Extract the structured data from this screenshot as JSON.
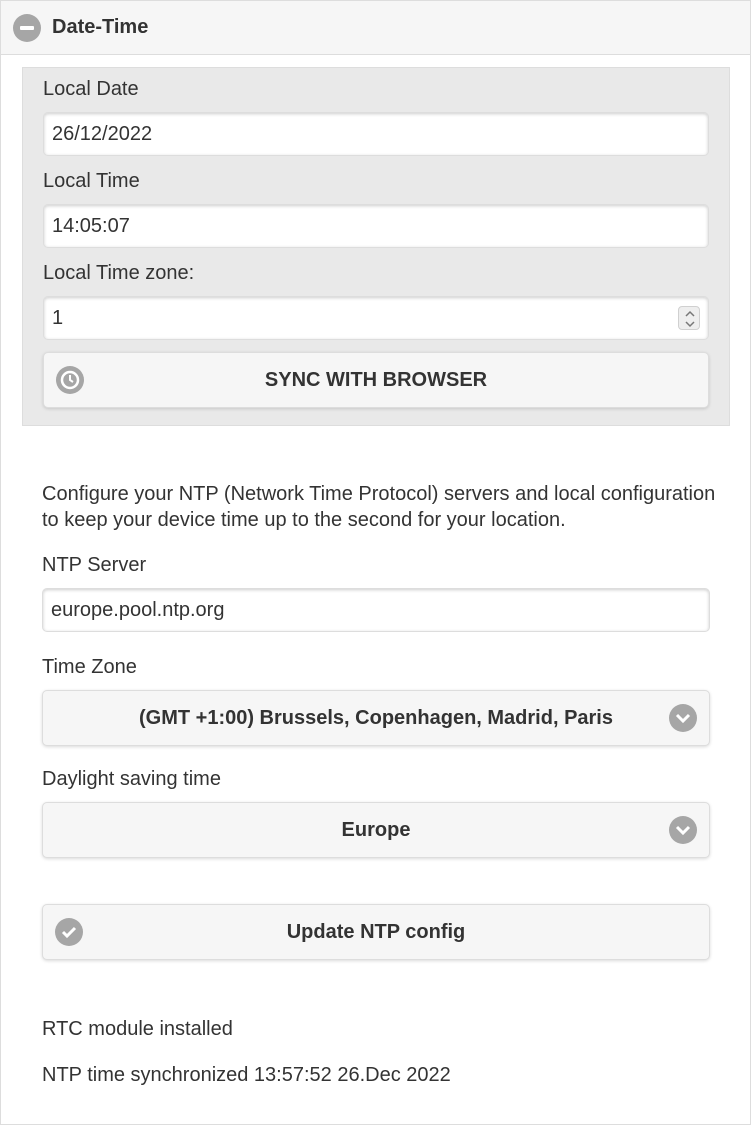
{
  "header": {
    "title": "Date-Time",
    "icon": "minus-circle-icon"
  },
  "local": {
    "date_label": "Local Date",
    "date_value": "26/12/2022",
    "time_label": "Local Time",
    "time_value": "14:05:07",
    "timezone_label": "Local Time zone:",
    "timezone_value": "1",
    "sync_button_label": "SYNC WITH BROWSER",
    "sync_button_icon": "clock-icon"
  },
  "ntp": {
    "description": "Configure your NTP (Network Time Protocol) servers and local configuration to keep your device time up to the second for your location.",
    "server_label": "NTP Server",
    "server_value": "europe.pool.ntp.org",
    "timezone_label": "Time Zone",
    "timezone_selected": "(GMT +1:00) Brussels, Copenhagen, Madrid, Paris",
    "dst_label": "Daylight saving time",
    "dst_selected": "Europe",
    "update_button_label": "Update NTP config",
    "update_button_icon": "check-circle-icon"
  },
  "status": {
    "rtc": "RTC module installed",
    "sync": "NTP time synchronized 13:57:52 26.Dec 2022"
  },
  "colors": {
    "header_bg": "#f6f6f6",
    "panel_bg": "#e9e9e9",
    "icon_grey": "#a6a6a6",
    "text": "#333333"
  }
}
